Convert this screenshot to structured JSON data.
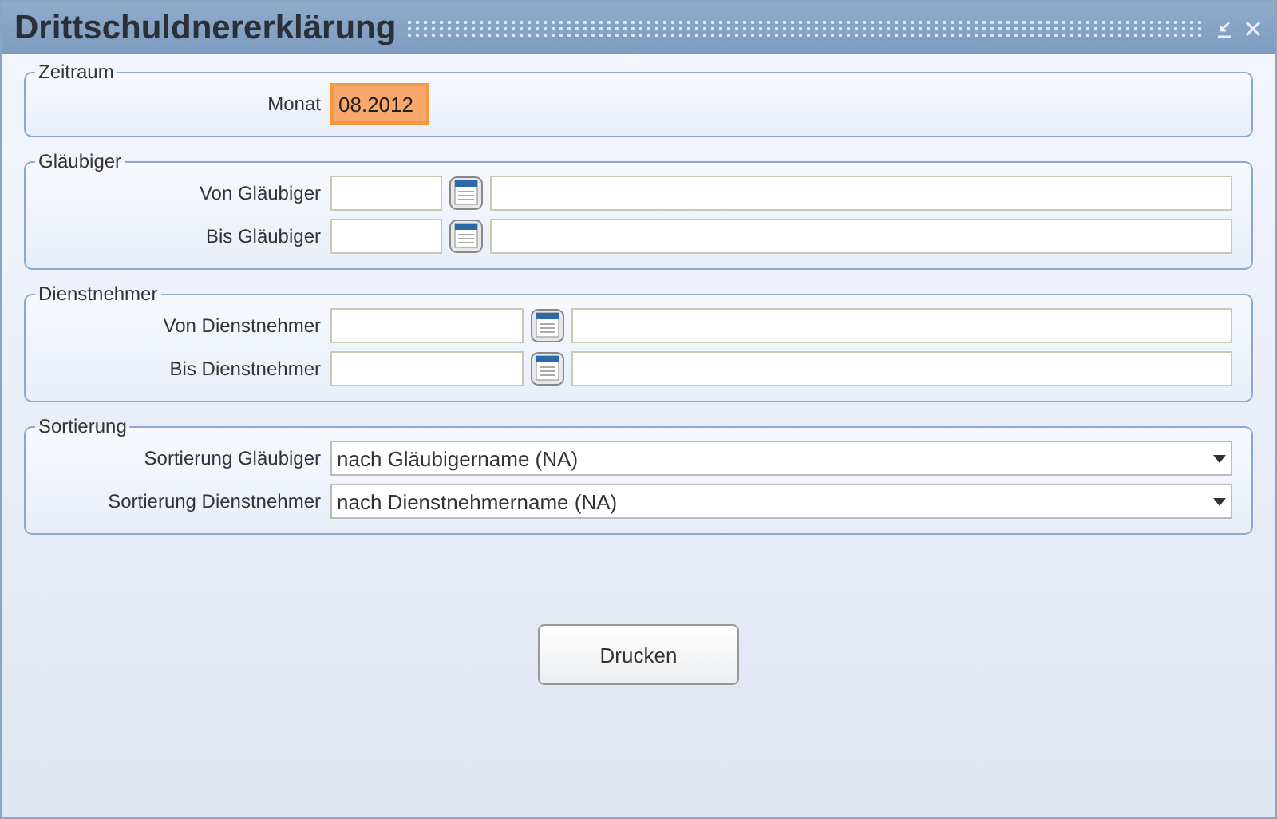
{
  "window": {
    "title": "Drittschuldnererklärung"
  },
  "groups": [
    {
      "title": "Zeitraum",
      "rows": [
        {
          "kind": "text",
          "label": "Monat",
          "value": "08.2012",
          "focused": true
        }
      ]
    },
    {
      "title": "Gläubiger",
      "rows": [
        {
          "kind": "lookup",
          "label": "Von Gläubiger"
        },
        {
          "kind": "lookup",
          "label": "Bis Gläubiger"
        }
      ]
    },
    {
      "title": "Dienstnehmer",
      "rows": [
        {
          "kind": "lookup-wide",
          "label": "Von Dienstnehmer"
        },
        {
          "kind": "lookup-wide",
          "label": "Bis Dienstnehmer"
        }
      ]
    },
    {
      "title": "Sortierung",
      "rows": [
        {
          "kind": "select",
          "label": "Sortierung Gläubiger",
          "value": "nach Gläubigername (NA)"
        },
        {
          "kind": "select",
          "label": "Sortierung Dienstnehmer",
          "value": "nach Dienstnehmername (NA)"
        }
      ]
    }
  ],
  "buttons": [
    "Drucken"
  ]
}
